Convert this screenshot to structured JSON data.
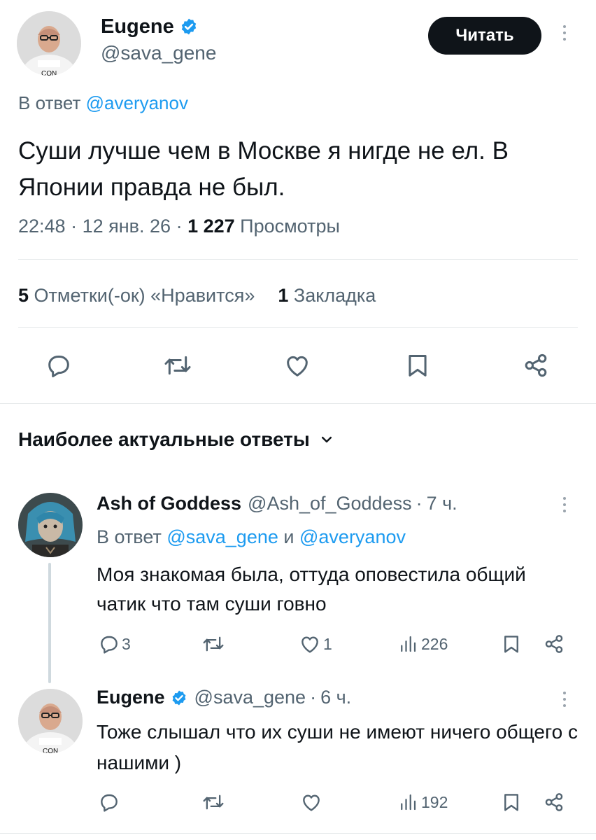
{
  "main_tweet": {
    "author_name": "Eugene",
    "handle": "@sava_gene",
    "follow_button_label": "Читать",
    "reply_prefix": "В ответ",
    "reply_to": "@averyanov",
    "text": "Суши лучше чем в Москве я нигде не ел. В Японии правда не был.",
    "time": "22:48",
    "date": "12 янв. 26",
    "views_count": "1 227",
    "views_label": "Просмотры",
    "likes_count": "5",
    "likes_label": "Отметки(-ок) «Нравится»",
    "bookmarks_count": "1",
    "bookmarks_label": "Закладка"
  },
  "replies_section": {
    "title": "Наиболее актуальные ответы"
  },
  "replies": [
    {
      "author_name": "Ash of Goddess",
      "handle": "@Ash_of_Goddess",
      "time": "7 ч.",
      "reply_prefix": "В ответ",
      "reply_to_1": "@sava_gene",
      "reply_conj": "и",
      "reply_to_2": "@averyanov",
      "text": "Моя знакомая была, оттуда оповестила общий чатик что там суши говно",
      "reply_count": "3",
      "like_count": "1",
      "view_count": "226"
    },
    {
      "author_name": "Eugene",
      "handle": "@sava_gene",
      "time": "6 ч.",
      "text": "Тоже слышал что их суши не имеют ничего общего с нашими )",
      "view_count": "192"
    }
  ],
  "colors": {
    "accent": "#1d9bf0",
    "text": "#0f1419",
    "secondary": "#536471",
    "button_bg": "#0f1419"
  },
  "icons": [
    "verified-badge-icon",
    "more-dots-icon",
    "reply-icon",
    "retweet-icon",
    "like-icon",
    "bookmark-icon",
    "share-icon",
    "views-icon",
    "chevron-down-icon"
  ]
}
